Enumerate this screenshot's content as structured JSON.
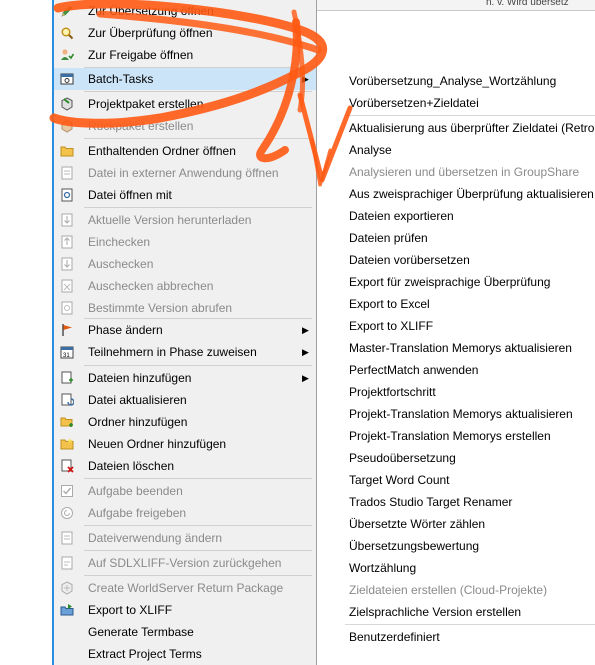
{
  "background": {
    "top_text": "n. v.   Wird übersetz"
  },
  "menu": {
    "items": [
      {
        "label": "Zur Übersetzung öffnen",
        "icon": "pencil-icon",
        "enabled": true
      },
      {
        "label": "Zur Überprüfung öffnen",
        "icon": "magnifier-icon",
        "enabled": true
      },
      {
        "label": "Zur Freigabe öffnen",
        "icon": "user-sign-off-icon",
        "enabled": true
      },
      {
        "label": "Batch-Tasks",
        "icon": "batch-tasks-icon",
        "enabled": true,
        "submenu": true,
        "highlighted": true
      },
      {
        "label": "Projektpaket erstellen",
        "icon": "package-create-icon",
        "enabled": true
      },
      {
        "label": "Rückpaket erstellen",
        "icon": "return-package-icon",
        "enabled": false
      },
      {
        "label": "Enthaltenden Ordner öffnen",
        "icon": "folder-open-icon",
        "enabled": true
      },
      {
        "label": "Datei in externer Anwendung öffnen",
        "icon": "external-app-icon",
        "enabled": false
      },
      {
        "label": "Datei öffnen mit",
        "icon": "open-with-icon",
        "enabled": true
      },
      {
        "label": "Aktuelle Version herunterladen",
        "icon": "download-icon",
        "enabled": false
      },
      {
        "label": "Einchecken",
        "icon": "check-in-icon",
        "enabled": false
      },
      {
        "label": "Auschecken",
        "icon": "check-out-icon",
        "enabled": false
      },
      {
        "label": "Auschecken abbrechen",
        "icon": "undo-checkout-icon",
        "enabled": false
      },
      {
        "label": "Bestimmte Version abrufen",
        "icon": "get-version-icon",
        "enabled": false
      },
      {
        "label": "Phase ändern",
        "icon": "flag-icon",
        "enabled": true,
        "submenu": true
      },
      {
        "label": "Teilnehmern in Phase zuweisen",
        "icon": "calendar-icon",
        "enabled": true,
        "submenu": true
      },
      {
        "label": "Dateien hinzufügen",
        "icon": "add-files-icon",
        "enabled": true,
        "submenu": true
      },
      {
        "label": "Datei aktualisieren",
        "icon": "update-file-icon",
        "enabled": true
      },
      {
        "label": "Ordner hinzufügen",
        "icon": "add-folder-icon",
        "enabled": true
      },
      {
        "label": "Neuen Ordner hinzufügen",
        "icon": "new-folder-icon",
        "enabled": true
      },
      {
        "label": "Dateien löschen",
        "icon": "delete-files-icon",
        "enabled": true
      },
      {
        "label": "Aufgabe beenden",
        "icon": "complete-task-icon",
        "enabled": false
      },
      {
        "label": "Aufgabe freigeben",
        "icon": "release-task-icon",
        "enabled": false
      },
      {
        "label": "Dateiverwendung ändern",
        "icon": "file-usage-icon",
        "enabled": false
      },
      {
        "label": "Auf SDLXLIFF-Version zurückgehen",
        "icon": "revert-icon",
        "enabled": false
      },
      {
        "label": "Create WorldServer Return Package",
        "icon": "worldserver-icon",
        "enabled": false
      },
      {
        "label": "Export to XLIFF",
        "icon": "export-xliff-icon",
        "enabled": true
      },
      {
        "label": "Generate Termbase",
        "icon": "",
        "enabled": true
      },
      {
        "label": "Extract Project Terms",
        "icon": "",
        "enabled": true
      }
    ]
  },
  "submenu": {
    "items": [
      {
        "label": "Vorübersetzung_Analyse_Wortzählung",
        "enabled": true
      },
      {
        "label": "Vorübersetzen+Zieldatei",
        "enabled": true
      },
      {
        "label": "Aktualisierung aus überprüfter Zieldatei (Retro",
        "enabled": true
      },
      {
        "label": "Analyse",
        "enabled": true
      },
      {
        "label": "Analysieren und übersetzen in GroupShare",
        "enabled": false
      },
      {
        "label": "Aus zweisprachiger Überprüfung aktualisieren",
        "enabled": true
      },
      {
        "label": "Dateien exportieren",
        "enabled": true
      },
      {
        "label": "Dateien prüfen",
        "enabled": true
      },
      {
        "label": "Dateien vorübersetzen",
        "enabled": true
      },
      {
        "label": "Export für zweisprachige Überprüfung",
        "enabled": true
      },
      {
        "label": "Export to Excel",
        "enabled": true
      },
      {
        "label": "Export to XLIFF",
        "enabled": true
      },
      {
        "label": "Master-Translation Memorys aktualisieren",
        "enabled": true
      },
      {
        "label": "PerfectMatch anwenden",
        "enabled": true
      },
      {
        "label": "Projektfortschritt",
        "enabled": true
      },
      {
        "label": "Projekt-Translation Memorys aktualisieren",
        "enabled": true
      },
      {
        "label": "Projekt-Translation Memorys erstellen",
        "enabled": true
      },
      {
        "label": "Pseudoübersetzung",
        "enabled": true
      },
      {
        "label": "Target Word Count",
        "enabled": true
      },
      {
        "label": "Trados Studio Target Renamer",
        "enabled": true
      },
      {
        "label": "Übersetzte Wörter zählen",
        "enabled": true
      },
      {
        "label": "Übersetzungsbewertung",
        "enabled": true
      },
      {
        "label": "Wortzählung",
        "enabled": true
      },
      {
        "label": "Zieldateien erstellen (Cloud-Projekte)",
        "enabled": false
      },
      {
        "label": "Zielsprachliche Version erstellen",
        "enabled": true
      },
      {
        "label": "Benutzerdefiniert",
        "enabled": true
      }
    ]
  },
  "colors": {
    "highlight": "#cce4f7",
    "scribble": "#ff5a14",
    "accent": "#2a8ee0"
  }
}
